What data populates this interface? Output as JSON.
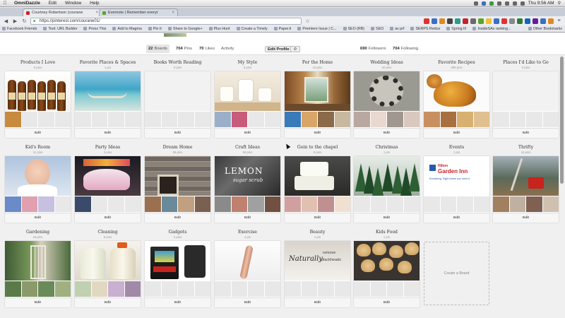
{
  "menubar": {
    "app": "OmniDazzle",
    "items": [
      "Edit",
      "Window",
      "Help"
    ],
    "clock": "Thu 9:56 AM"
  },
  "tabs": [
    {
      "title": "Courtney Robertson (courane",
      "active": true,
      "color": "#c8232c"
    },
    {
      "title": "Evernote | Remember everyt",
      "active": false,
      "color": "#5ba525"
    }
  ],
  "toolbar": {
    "url": "https://pinterest.com/courane01/"
  },
  "bookmarks": [
    "Facebook Friends",
    "Tool: URL Builder",
    "Press This",
    "Add to Magma",
    "Pin It",
    "Share to Google+",
    "Plus Hunt",
    "Create a Timely",
    "Paper.li",
    "Premiere Issue | C...",
    "SEO (RB)",
    "SEO",
    "av prf",
    "SERPS Redux",
    "Spring It!",
    "InsideSAx ranking..."
  ],
  "bookmarks_other": "Other Bookmarks",
  "profile": {
    "boards_count": "22",
    "boards_label": "Boards",
    "pins_count": "704",
    "pins_label": "Pins",
    "likes_count": "70",
    "likes_label": "Likes",
    "activity_label": "Activity",
    "edit_profile": "Edit Profile",
    "followers_count": "690",
    "followers_label": "Followers",
    "following_count": "704",
    "following_label": "Following"
  },
  "edit_label": "Edit",
  "create_board_label": "Create a Board",
  "boards": [
    {
      "title": "Products I Love",
      "pins": "6 pins",
      "cover": "bottles",
      "thumbs": [
        "#c88a3e",
        "#e8e8e8",
        "#e8e8e8",
        "#e8e8e8"
      ]
    },
    {
      "title": "Favorite Places & Spaces",
      "pins": "1 pin",
      "cover": "beach",
      "thumbs": [
        "#e8e8e8",
        "#e8e8e8",
        "#e8e8e8",
        "#e8e8e8"
      ]
    },
    {
      "title": "Books Worth Reading",
      "pins": "0 pins",
      "cover": "empty",
      "thumbs": [
        "#e8e8e8",
        "#e8e8e8",
        "#e8e8e8",
        "#e8e8e8"
      ]
    },
    {
      "title": "My Style",
      "pins": "3 pins",
      "cover": "bath",
      "thumbs": [
        "#9bb0c8",
        "#c85a7a",
        "#e8e8e8",
        "#e8e8e8"
      ]
    },
    {
      "title": "For the Home",
      "pins": "10 pins",
      "cover": "room",
      "thumbs": [
        "#3a7ab8",
        "#d9a66a",
        "#8a6a4a",
        "#c9b8a0"
      ]
    },
    {
      "title": "Wedding Ideas",
      "pins": "20 pins",
      "cover": "crowd",
      "thumbs": [
        "#b8a8a0",
        "#e8d8d0",
        "#a09890",
        "#d8c8c0"
      ]
    },
    {
      "title": "Favorite Recipes",
      "pins": "388 pins",
      "cover": "muffin",
      "thumbs": [
        "#c89060",
        "#a87040",
        "#d8b070",
        "#e0c090"
      ]
    },
    {
      "title": "Places I'd Like to Go",
      "pins": "0 pins",
      "cover": "empty",
      "thumbs": [
        "#e8e8e8",
        "#e8e8e8",
        "#e8e8e8",
        "#e8e8e8"
      ]
    },
    {
      "title": "Kid's Room",
      "pins": "11 pins",
      "cover": "baby",
      "thumbs": [
        "#6a8ac8",
        "#e0a0b0",
        "#c8c0e0",
        "#e8e8e8"
      ]
    },
    {
      "title": "Party Ideas",
      "pins": "0 pins",
      "cover": "cake",
      "thumbs": [
        "#3a4a6a",
        "#e8e8e8",
        "#e8e8e8",
        "#e8e8e8"
      ]
    },
    {
      "title": "Dream Home",
      "pins": "26 pins",
      "cover": "fireplace",
      "thumbs": [
        "#9a7050",
        "#6a8a9a",
        "#c0a080",
        "#7a6050"
      ]
    },
    {
      "title": "Craft Ideas",
      "pins": "38 pins",
      "cover": "lemon",
      "thumbs": [
        "#8a8a8a",
        "#c08070",
        "#a0a0a0",
        "#705040"
      ]
    },
    {
      "title": "Goin to the chapel",
      "pins": "8 pins",
      "cover": "weddingcake",
      "thumbs": [
        "#d0a0a0",
        "#e0c0b0",
        "#c09090",
        "#f0e0d0"
      ]
    },
    {
      "title": "Christmas",
      "pins": "1 pin",
      "cover": "trees",
      "thumbs": [
        "#e8e8e8",
        "#e8e8e8",
        "#e8e8e8",
        "#e8e8e8"
      ]
    },
    {
      "title": "Events",
      "pins": "1 pin",
      "cover": "hilton",
      "thumbs": [
        "#e8e8e8",
        "#e8e8e8",
        "#e8e8e8",
        "#e8e8e8"
      ]
    },
    {
      "title": "Thrifty",
      "pins": "16 pins",
      "cover": "thrifty",
      "thumbs": [
        "#a08060",
        "#c0b0a0",
        "#806050",
        "#d0c0b0"
      ]
    },
    {
      "title": "Gardening",
      "pins": "19 pins",
      "cover": "garden",
      "thumbs": [
        "#5a7a4a",
        "#8a9a6a",
        "#6a8a5a",
        "#a0b080"
      ]
    },
    {
      "title": "Cleaning",
      "pins": "8 pins",
      "cover": "jugs",
      "thumbs": [
        "#c0d0b0",
        "#e0d8c0",
        "#c8b0d0",
        "#a08aa8"
      ]
    },
    {
      "title": "Gadgets",
      "pins": "2 pins",
      "cover": "arcade",
      "thumbs": [
        "#e8e8e8",
        "#e8e8e8",
        "#e8e8e8",
        "#e8e8e8"
      ]
    },
    {
      "title": "Exercise",
      "pins": "1 pin",
      "cover": "leg",
      "thumbs": [
        "#e8e8e8",
        "#e8e8e8",
        "#e8e8e8",
        "#e8e8e8"
      ]
    },
    {
      "title": "Beauty",
      "pins": "1 pin",
      "cover": "naturally",
      "thumbs": [
        "#e8e8e8",
        "#e8e8e8",
        "#e8e8e8",
        "#e8e8e8"
      ]
    },
    {
      "title": "Kids Food",
      "pins": "1 pin",
      "cover": "cookies",
      "thumbs": [
        "#e8e8e8",
        "#e8e8e8",
        "#e8e8e8",
        "#e8e8e8"
      ]
    }
  ],
  "cover_texts": {
    "lemon_a": "LEMON",
    "lemon_b": "sugar scrub",
    "hilton_a": "Hilton",
    "hilton_b": "Garden Inn",
    "hilton_c": "Everything. Right where you need it.",
    "naturally_a": "Naturally",
    "naturally_b": "remove",
    "naturally_c": "blackheads"
  }
}
